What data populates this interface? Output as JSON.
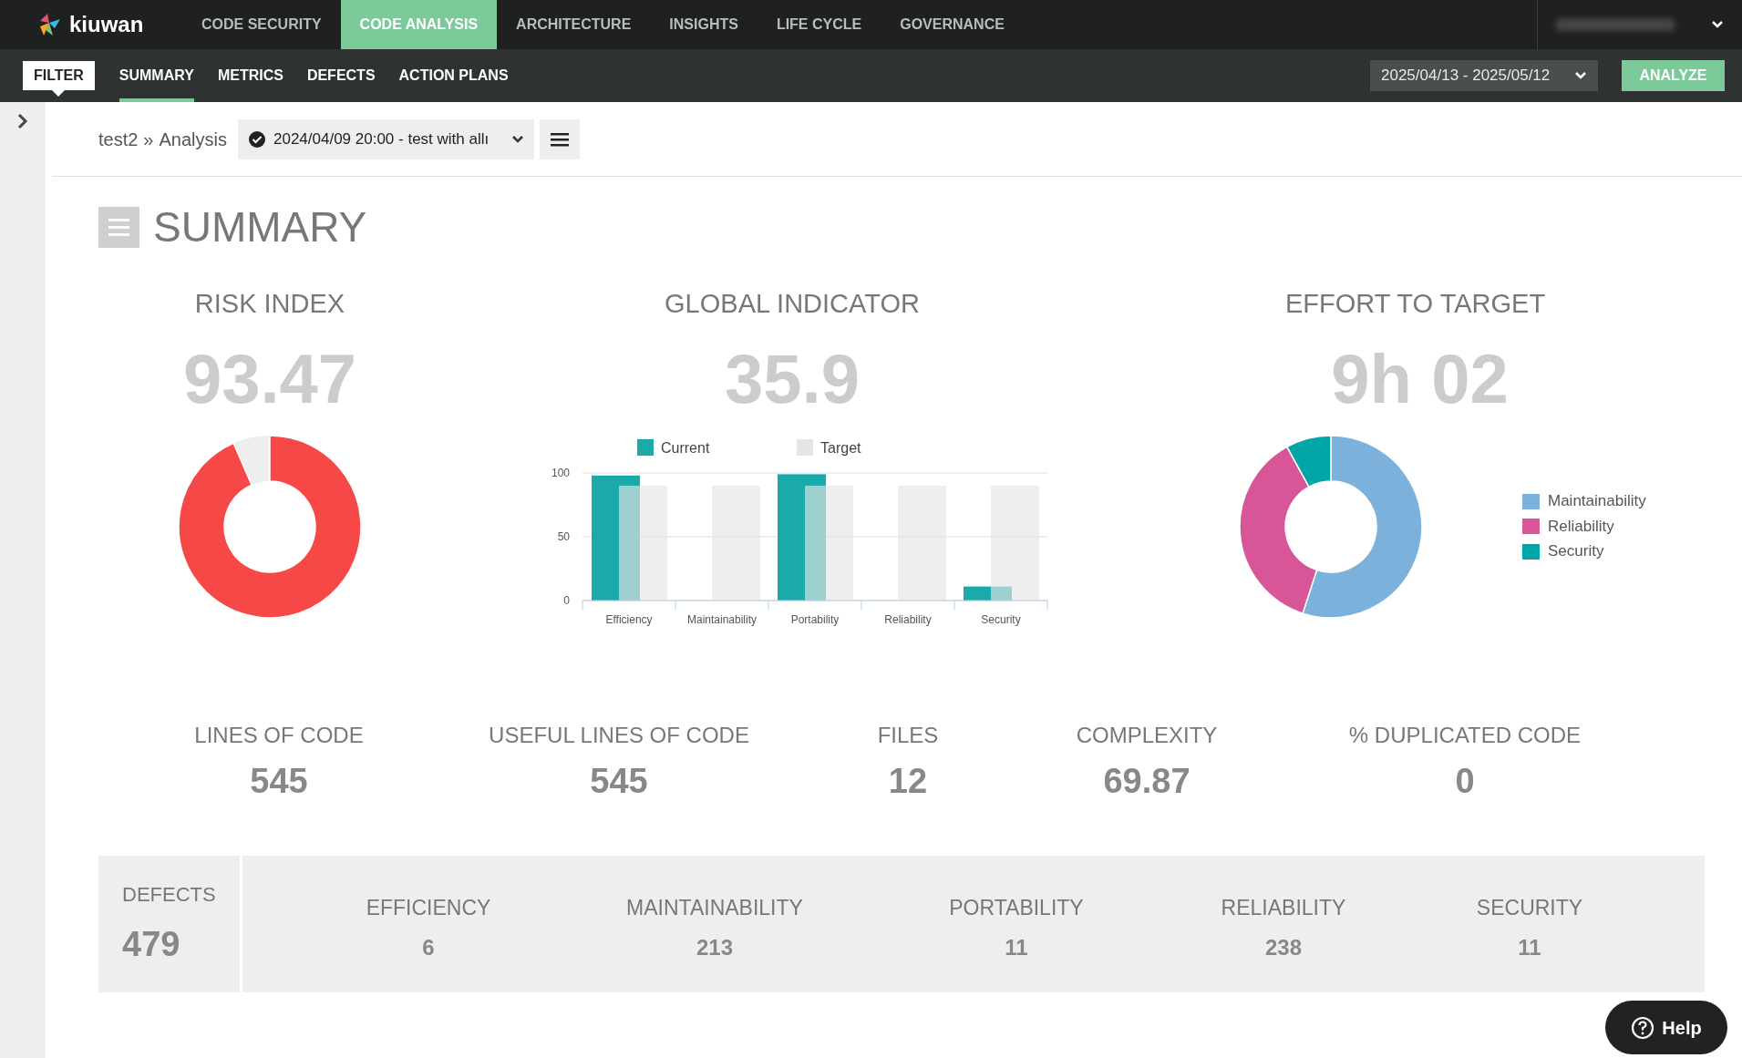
{
  "top_nav": {
    "tabs": [
      {
        "label": "CODE SECURITY",
        "selected": false
      },
      {
        "label": "CODE ANALYSIS",
        "selected": true
      },
      {
        "label": "ARCHITECTURE",
        "selected": false
      },
      {
        "label": "INSIGHTS",
        "selected": false
      },
      {
        "label": "LIFE CYCLE",
        "selected": false
      },
      {
        "label": "GOVERNANCE",
        "selected": false
      }
    ],
    "logo": "kiuwan"
  },
  "sub_nav": {
    "filter": "FILTER",
    "tabs": [
      {
        "label": "SUMMARY",
        "selected": true
      },
      {
        "label": "METRICS",
        "selected": false
      },
      {
        "label": "DEFECTS",
        "selected": false
      },
      {
        "label": "ACTION PLANS",
        "selected": false
      }
    ],
    "date_range": "2025/04/13 - 2025/05/12",
    "analyze": "ANALYZE"
  },
  "breadcrumb": {
    "app": "test2",
    "separator": "»",
    "page": "Analysis",
    "analysis": "2024/04/09 20:00 - test with allı"
  },
  "heading": "SUMMARY",
  "risk_index": {
    "title": "RISK INDEX",
    "value": "93.47"
  },
  "global_indicator": {
    "title": "GLOBAL INDICATOR",
    "value": "35.9",
    "chart_data": {
      "type": "bar",
      "categories": [
        "Efficiency",
        "Maintainability",
        "Portability",
        "Reliability",
        "Security"
      ],
      "series": [
        {
          "name": "Current",
          "color": "#1aaaa9",
          "values": [
            98,
            0,
            99,
            0,
            11
          ]
        },
        {
          "name": "Target",
          "color": "#e5e5e5",
          "values": [
            90,
            90,
            90,
            90,
            90
          ]
        }
      ],
      "ylim": [
        0,
        100
      ],
      "yticks": [
        0,
        50,
        100
      ],
      "legend": "top"
    }
  },
  "effort_to_target": {
    "title": "EFFORT TO TARGET",
    "value": "9h 02",
    "legend": [
      {
        "label": "Maintainability",
        "color": "#7bb1db"
      },
      {
        "label": "Reliability",
        "color": "#d85598"
      },
      {
        "label": "Security",
        "color": "#00a5a5"
      }
    ]
  },
  "metrics": [
    {
      "label": "LINES OF CODE",
      "value": "545"
    },
    {
      "label": "USEFUL LINES OF CODE",
      "value": "545"
    },
    {
      "label": "FILES",
      "value": "12"
    },
    {
      "label": "COMPLEXITY",
      "value": "69.87"
    },
    {
      "label": "% DUPLICATED CODE",
      "value": "0"
    }
  ],
  "defects": {
    "label": "DEFECTS",
    "value": "479",
    "categories": [
      {
        "label": "EFFICIENCY",
        "value": "6"
      },
      {
        "label": "MAINTAINABILITY",
        "value": "213"
      },
      {
        "label": "PORTABILITY",
        "value": "11"
      },
      {
        "label": "RELIABILITY",
        "value": "238"
      },
      {
        "label": "SECURITY",
        "value": "11"
      }
    ]
  },
  "help": "Help"
}
